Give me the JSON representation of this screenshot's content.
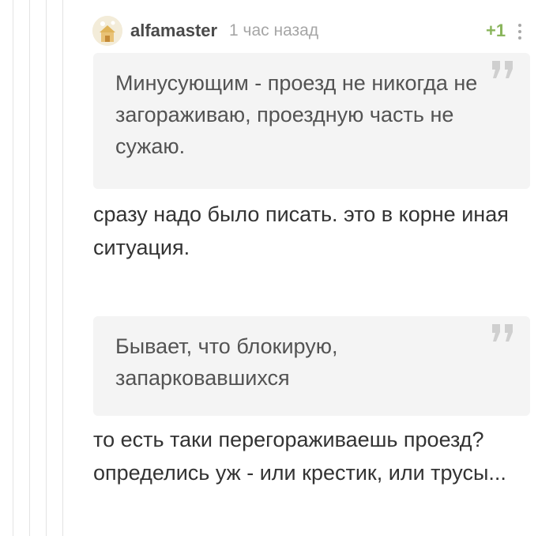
{
  "comment": {
    "username": "alfamaster",
    "timestamp": "1 час назад",
    "rating": "+1",
    "avatar_icon": "avatar-house-icon",
    "more_icon": "more-vertical-icon"
  },
  "blocks": [
    {
      "type": "quote",
      "text": "Минусующим - проезд не никогда не загораживаю, проездную часть не сужаю."
    },
    {
      "type": "reply",
      "text": "сразу надо было писать. это в корне иная ситуация."
    },
    {
      "type": "quote",
      "text": "Бывает, что блокирую, запарковавшихся"
    },
    {
      "type": "reply",
      "text": "то есть таки перегораживаешь проезд? определись уж - или крестик, или трусы..."
    }
  ],
  "colors": {
    "rating": "#8ab55c",
    "quote_bg": "#f4f4f4",
    "thread_line": "#e3e3e3"
  }
}
